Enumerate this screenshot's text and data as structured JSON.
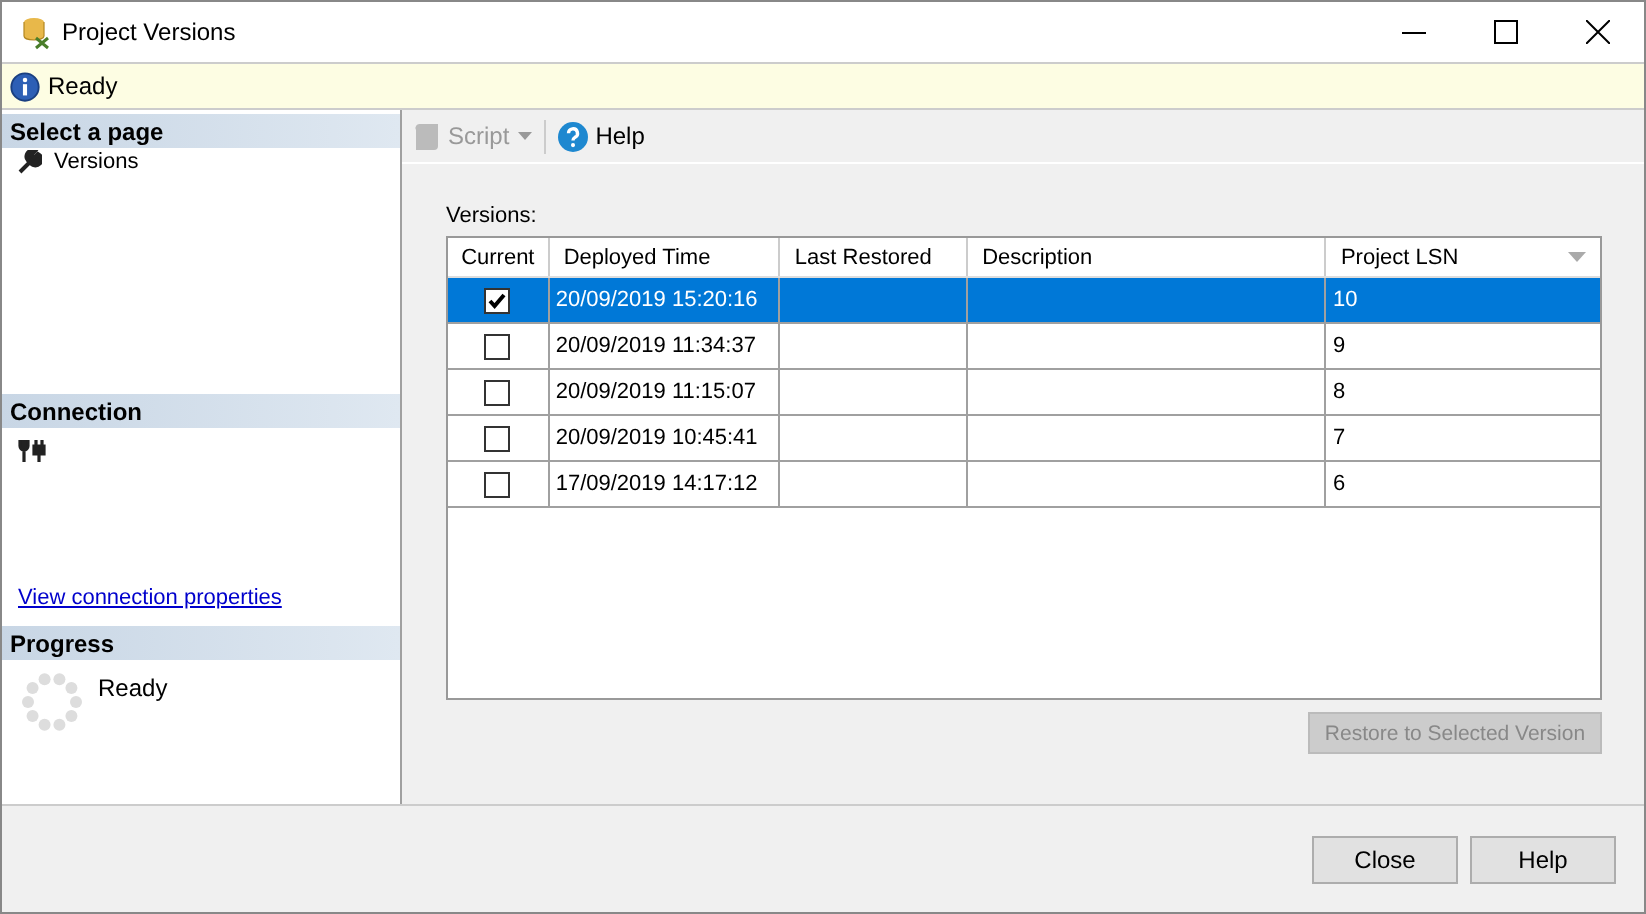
{
  "window": {
    "title": "Project Versions"
  },
  "status_bar": {
    "text": "Ready"
  },
  "sidebar": {
    "select_header": "Select a page",
    "pages": [
      {
        "label": "Versions",
        "selected": false
      }
    ],
    "connection_header": "Connection",
    "connection_link": "View connection properties",
    "progress_header": "Progress",
    "progress_text": "Ready"
  },
  "toolbar": {
    "items": [
      {
        "kind": "script",
        "label": "Script",
        "disabled": true
      },
      {
        "kind": "help",
        "label": "Help",
        "disabled": false
      }
    ]
  },
  "versions_label": "Versions:",
  "table": {
    "columns": [
      "Current",
      "Deployed Time",
      "Last Restored",
      "Description",
      "Project LSN"
    ],
    "rows": [
      {
        "current": true,
        "deployed": "20/09/2019 15:20:16",
        "lsn": "10",
        "selected": true
      },
      {
        "current": false,
        "deployed": "20/09/2019 11:34:37",
        "lsn": "9",
        "selected": false
      },
      {
        "current": false,
        "deployed": "20/09/2019 11:15:07",
        "lsn": "8",
        "selected": false
      },
      {
        "current": false,
        "deployed": "20/09/2019 10:45:41",
        "lsn": "7",
        "selected": false
      },
      {
        "current": false,
        "deployed": "17/09/2019 14:17:12",
        "lsn": "6",
        "selected": false
      }
    ]
  },
  "restore_button": {
    "label": "Restore to Selected Version",
    "disabled": true
  },
  "buttons": [
    "Close",
    "Help"
  ]
}
